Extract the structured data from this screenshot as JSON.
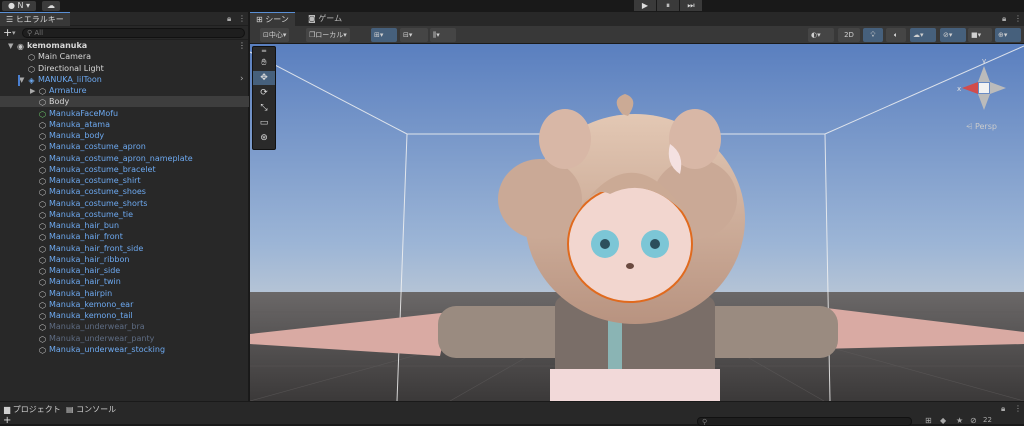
{
  "topbar": {
    "account_label": "N",
    "play": "▶",
    "pause": "⏸",
    "step": "⏭"
  },
  "hierarchy": {
    "tab_label": "ヒエラルキー",
    "search_placeholder": "All",
    "add_label": "+",
    "rows": [
      {
        "label": "kemomanuka",
        "indent": 0,
        "style": "white",
        "bold": true,
        "arrow": "▼",
        "icon": "unity-scene-icon"
      },
      {
        "label": "Main Camera",
        "indent": 1,
        "style": "white",
        "arrow": "",
        "icon": "cube-icon"
      },
      {
        "label": "Directional Light",
        "indent": 1,
        "style": "white",
        "arrow": "",
        "icon": "cube-icon"
      },
      {
        "label": "MANUKA_lilToon",
        "indent": 1,
        "style": "blue",
        "arrow": "▼",
        "icon": "prefab-icon"
      },
      {
        "label": "Armature",
        "indent": 2,
        "style": "blue",
        "arrow": "▶",
        "icon": "cube-icon"
      },
      {
        "label": "Body",
        "indent": 2,
        "style": "white",
        "arrow": "",
        "icon": "cube-icon",
        "selected": true
      },
      {
        "label": "ManukaFaceMofu",
        "indent": 2,
        "style": "blue",
        "arrow": "",
        "icon": "cube-icon"
      },
      {
        "label": "Manuka_atama",
        "indent": 2,
        "style": "blue",
        "arrow": "",
        "icon": "cube-icon"
      },
      {
        "label": "Manuka_body",
        "indent": 2,
        "style": "blue",
        "arrow": "",
        "icon": "cube-icon"
      },
      {
        "label": "Manuka_costume_apron",
        "indent": 2,
        "style": "blue",
        "arrow": "",
        "icon": "cube-icon"
      },
      {
        "label": "Manuka_costume_apron_nameplate",
        "indent": 2,
        "style": "blue",
        "arrow": "",
        "icon": "cube-icon"
      },
      {
        "label": "Manuka_costume_bracelet",
        "indent": 2,
        "style": "blue",
        "arrow": "",
        "icon": "cube-icon"
      },
      {
        "label": "Manuka_costume_shirt",
        "indent": 2,
        "style": "blue",
        "arrow": "",
        "icon": "cube-icon"
      },
      {
        "label": "Manuka_costume_shoes",
        "indent": 2,
        "style": "blue",
        "arrow": "",
        "icon": "cube-icon"
      },
      {
        "label": "Manuka_costume_shorts",
        "indent": 2,
        "style": "blue",
        "arrow": "",
        "icon": "cube-icon"
      },
      {
        "label": "Manuka_costume_tie",
        "indent": 2,
        "style": "blue",
        "arrow": "",
        "icon": "cube-icon"
      },
      {
        "label": "Manuka_hair_bun",
        "indent": 2,
        "style": "blue",
        "arrow": "",
        "icon": "cube-icon"
      },
      {
        "label": "Manuka_hair_front",
        "indent": 2,
        "style": "blue",
        "arrow": "",
        "icon": "cube-icon"
      },
      {
        "label": "Manuka_hair_front_side",
        "indent": 2,
        "style": "blue",
        "arrow": "",
        "icon": "cube-icon"
      },
      {
        "label": "Manuka_hair_ribbon",
        "indent": 2,
        "style": "blue",
        "arrow": "",
        "icon": "cube-icon"
      },
      {
        "label": "Manuka_hair_side",
        "indent": 2,
        "style": "blue",
        "arrow": "",
        "icon": "cube-icon"
      },
      {
        "label": "Manuka_hair_twin",
        "indent": 2,
        "style": "blue",
        "arrow": "",
        "icon": "cube-icon"
      },
      {
        "label": "Manuka_hairpin",
        "indent": 2,
        "style": "blue",
        "arrow": "",
        "icon": "cube-icon"
      },
      {
        "label": "Manuka_kemono_ear",
        "indent": 2,
        "style": "blue",
        "arrow": "",
        "icon": "cube-icon"
      },
      {
        "label": "Manuka_kemono_tail",
        "indent": 2,
        "style": "blue",
        "arrow": "",
        "icon": "cube-icon"
      },
      {
        "label": "Manuka_underwear_bra",
        "indent": 2,
        "style": "gray",
        "arrow": "",
        "icon": "cube-icon"
      },
      {
        "label": "Manuka_underwear_panty",
        "indent": 2,
        "style": "gray",
        "arrow": "",
        "icon": "cube-icon"
      },
      {
        "label": "Manuka_underwear_stocking",
        "indent": 2,
        "style": "blue",
        "arrow": "",
        "icon": "cube-icon"
      }
    ]
  },
  "scene": {
    "tab_scene": "シーン",
    "tab_game": "ゲーム",
    "pivot_label": "中心",
    "space_label": "ローカル",
    "mode_2d": "2D",
    "persp_label": "Persp",
    "gizmo_x": "x",
    "gizmo_y": "y"
  },
  "bottom": {
    "tab_project": "プロジェクト",
    "tab_console": "コンソール",
    "hidden_count": "22"
  },
  "colors": {
    "accent": "#46607c",
    "prefab_blue": "#6da9f0",
    "inactive_gray": "#5e6c83",
    "sky_top": "#5b82c4",
    "ground": "#4a4848"
  }
}
